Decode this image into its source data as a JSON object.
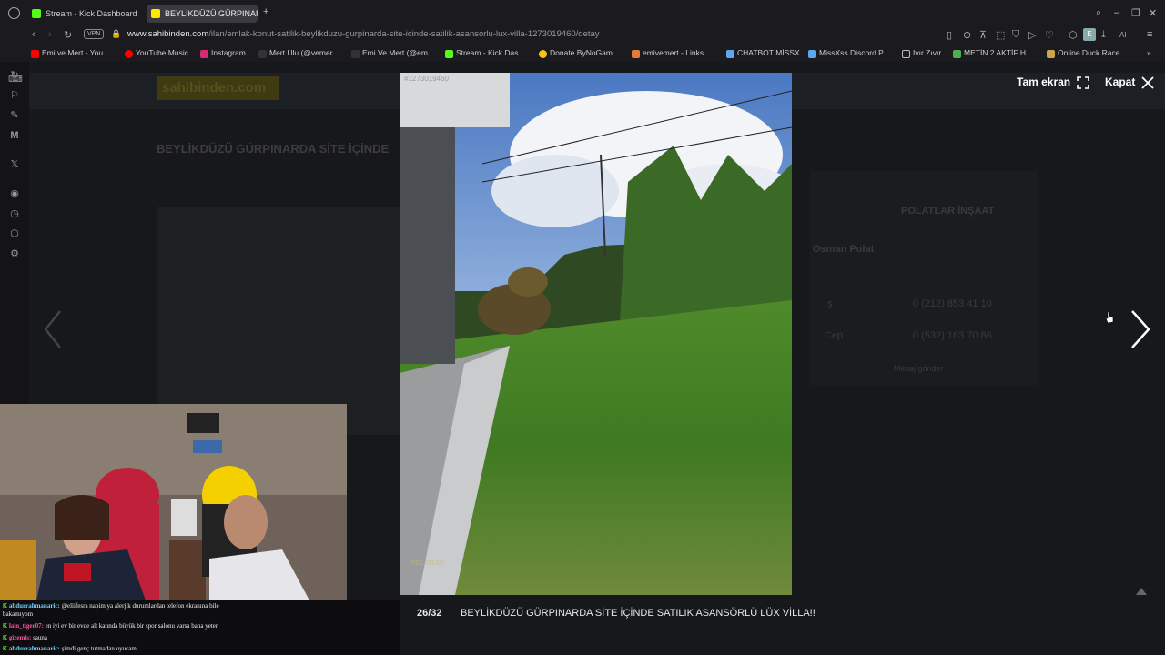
{
  "browser": {
    "tabs": [
      {
        "label": "Stream - Kick Dashboard",
        "color": "#53fc18"
      },
      {
        "label": "BEYLİKDÜZÜ GÜRPINARDA",
        "color": "#ffe800"
      }
    ],
    "vpn_label": "VPN",
    "url_host": "www.sahibinden.com",
    "url_path": "/ilan/emlak-konut-satilik-beylikduzu-gurpinarda-site-icinde-satilik-asansorlu-lux-villa-1273019460/detay",
    "ai_label": "AI"
  },
  "bookmarks": [
    {
      "label": "Emi ve Mert - You...",
      "color": "#ff0000"
    },
    {
      "label": "YouTube Music",
      "color": "#ff0000"
    },
    {
      "label": "Instagram",
      "color": "#d62976"
    },
    {
      "label": "Mert Ulu (@vemer...",
      "color": "#ffffff"
    },
    {
      "label": "Emi Ve Mert (@em...",
      "color": "#ffffff"
    },
    {
      "label": "Stream - Kick Das...",
      "color": "#53fc18"
    },
    {
      "label": "Donate ByNoGam...",
      "color": "#f5c518"
    },
    {
      "label": "emivemert - Links...",
      "color": "#e07b39"
    },
    {
      "label": "CHATBOT MİSSX",
      "color": "#5aa9f0"
    },
    {
      "label": "MissXss Discord P...",
      "color": "#5aa9f0"
    },
    {
      "label": "Ivır Zıvır",
      "color": "#cccccc"
    },
    {
      "label": "METİN 2 AKTİF H...",
      "color": "#4caf50"
    },
    {
      "label": "Online Duck Race...",
      "color": "#cfa54a"
    }
  ],
  "page_behind": {
    "logo": "sahibinden.com",
    "title": "BEYLİKDÜZÜ GÜRPINARDA SİTE İÇİNDE",
    "seller": "Osman Polat",
    "company": "POLATLAR İNŞAAT",
    "phone_work_label": "İş",
    "phone_work": "0 (212) 853 41 10",
    "phone_cell_label": "Cep",
    "phone_cell": "0 (532) 163 70 86",
    "message_button": "Mesaj gönder"
  },
  "lightbox": {
    "listing_id": "#1273019460",
    "fullscreen_label": "Tam ekran",
    "close_label": "Kapat",
    "counter": "26/32",
    "caption": "BEYLİKDÜZÜ GÜRPINARDA SİTE İÇİNDE SATILIK ASANSÖRLÜ LÜX VİLLA!!",
    "watermark": "POLATLAR"
  },
  "chat": [
    {
      "user": "abdurrahmanaric:",
      "user_color": "#6fd3ff",
      "message": "@eliifesra napim ya alerjik durumlardan telefon ekranına bile",
      "message2": "bakamıyom"
    },
    {
      "user": "lain_tiger07:",
      "user_color": "#ff4fa0",
      "message": "en iyi ev bir evde alt katında büyük bir spor salonu varsa bana yeter",
      "message2": ""
    },
    {
      "user": "gizemls:",
      "user_color": "#ff4fa0",
      "message": "sauna",
      "message2": ""
    },
    {
      "user": "abdurrahmanaric:",
      "user_color": "#6fd3ff",
      "message": "şimdi genç tutmadan uyucam",
      "message2": ""
    }
  ]
}
